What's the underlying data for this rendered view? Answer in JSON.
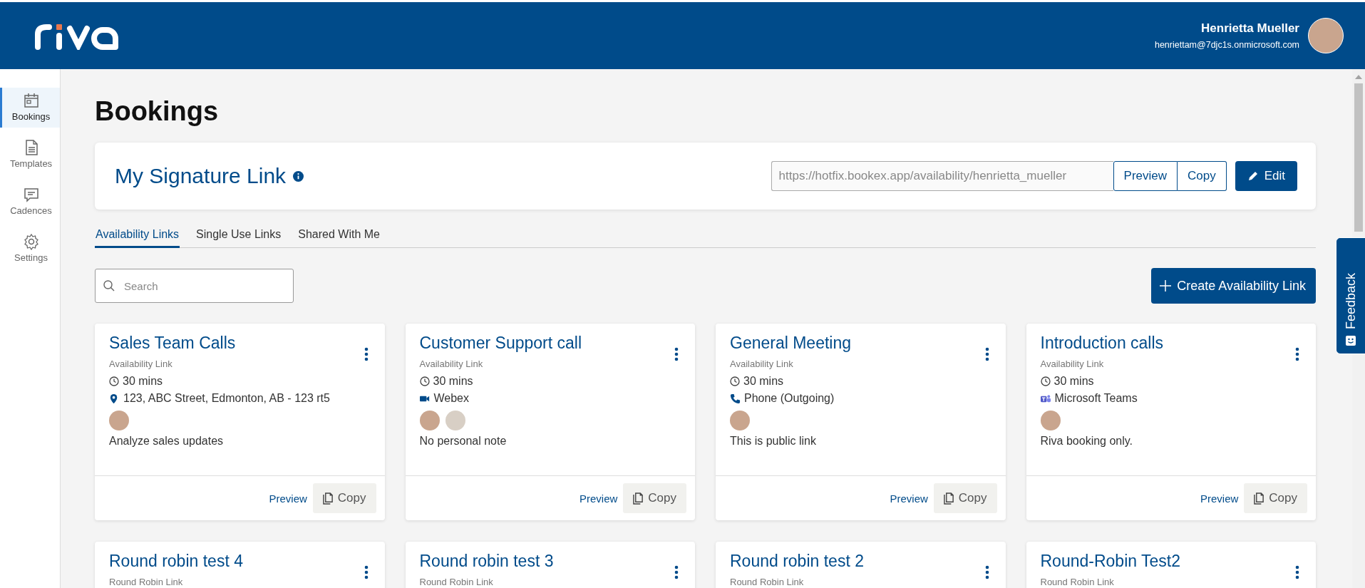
{
  "header": {
    "user_name": "Henrietta Mueller",
    "user_email": "henriettam@7djc1s.onmicrosoft.com"
  },
  "sidebar": {
    "items": [
      {
        "label": "Bookings",
        "kind": "calendar",
        "selected": true
      },
      {
        "label": "Templates",
        "kind": "document",
        "selected": false
      },
      {
        "label": "Cadences",
        "kind": "message",
        "selected": false
      },
      {
        "label": "Settings",
        "kind": "gear",
        "selected": false
      }
    ]
  },
  "page_title": "Bookings",
  "signature_link": {
    "title": "My Signature Link",
    "url": "https://hotfix.bookex.app/availability/henrietta_mueller",
    "preview_button": "Preview",
    "copy_button": "Copy",
    "edit_button": "Edit"
  },
  "tabs": [
    {
      "label": "Availability Links",
      "selected": true
    },
    {
      "label": "Single Use Links",
      "selected": false
    },
    {
      "label": "Shared With Me",
      "selected": false
    }
  ],
  "search": {
    "placeholder": "Search"
  },
  "create_button": "Create Availability Link",
  "cards": [
    {
      "title": "Sales Team Calls",
      "type": "Availability Link",
      "duration": "30 mins",
      "location": {
        "kind": "address",
        "text": "123, ABC Street, Edmonton, AB - 123 rt5"
      },
      "attendees": [
        {
          "kind": "photo"
        }
      ],
      "note": "Analyze sales updates",
      "preview": "Preview",
      "copy": "Copy"
    },
    {
      "title": "Customer Support call",
      "type": "Availability Link",
      "duration": "30 mins",
      "location": {
        "kind": "video",
        "text": "Webex"
      },
      "attendees": [
        {
          "kind": "photo"
        },
        {
          "kind": "photo"
        }
      ],
      "note": "No personal note",
      "preview": "Preview",
      "copy": "Copy"
    },
    {
      "title": "General Meeting",
      "type": "Availability Link",
      "duration": "30 mins",
      "location": {
        "kind": "phone",
        "text": "Phone (Outgoing)"
      },
      "attendees": [
        {
          "kind": "photo"
        }
      ],
      "note": "This is public link",
      "preview": "Preview",
      "copy": "Copy"
    },
    {
      "title": "Introduction calls",
      "type": "Availability Link",
      "duration": "30 mins",
      "location": {
        "kind": "teams",
        "text": "Microsoft Teams"
      },
      "attendees": [
        {
          "kind": "photo"
        }
      ],
      "note": "Riva booking only.",
      "preview": "Preview",
      "copy": "Copy"
    },
    {
      "title": "Round robin test 4",
      "type": "Round Robin Link"
    },
    {
      "title": "Round robin test 3",
      "type": "Round Robin Link"
    },
    {
      "title": "Round robin test 2",
      "type": "Round Robin Link"
    },
    {
      "title": "Round-Robin Test2",
      "type": "Round Robin Link"
    }
  ],
  "feedback_tab": "Feedback"
}
